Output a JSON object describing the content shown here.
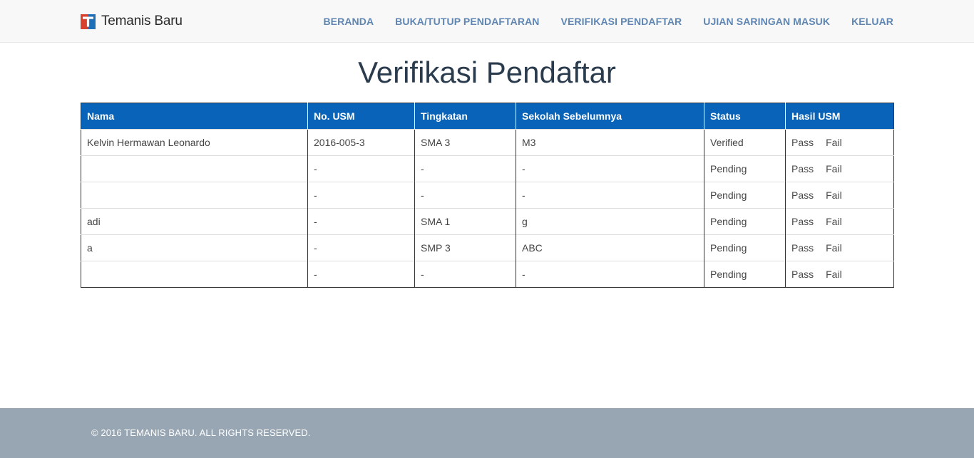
{
  "brand": {
    "name": "Temanis Baru",
    "logo_colors": {
      "left": "#d9412f",
      "right": "#1f6fb8"
    }
  },
  "nav": {
    "items": [
      {
        "label": "BERANDA"
      },
      {
        "label": "BUKA/TUTUP PENDAFTARAN"
      },
      {
        "label": "VERIFIKASI PENDAFTAR"
      },
      {
        "label": "UJIAN SARINGAN MASUK"
      },
      {
        "label": "KELUAR"
      }
    ]
  },
  "page": {
    "title": "Verifikasi Pendaftar"
  },
  "table": {
    "headers": [
      "Nama",
      "No. USM",
      "Tingkatan",
      "Sekolah Sebelumnya",
      "Status",
      "Hasil USM"
    ],
    "rows": [
      {
        "nama": "Kelvin Hermawan Leonardo",
        "usm": "2016-005-3",
        "tingkatan": "SMA 3",
        "sekolah": "M3",
        "status": "Verified",
        "pass": "Pass",
        "fail": "Fail"
      },
      {
        "nama": "",
        "usm": "-",
        "tingkatan": "-",
        "sekolah": "-",
        "status": "Pending",
        "pass": "Pass",
        "fail": "Fail"
      },
      {
        "nama": "",
        "usm": "-",
        "tingkatan": "-",
        "sekolah": "-",
        "status": "Pending",
        "pass": "Pass",
        "fail": "Fail"
      },
      {
        "nama": "adi",
        "usm": "-",
        "tingkatan": "SMA 1",
        "sekolah": "g",
        "status": "Pending",
        "pass": "Pass",
        "fail": "Fail"
      },
      {
        "nama": "a",
        "usm": "-",
        "tingkatan": "SMP 3",
        "sekolah": "ABC",
        "status": "Pending",
        "pass": "Pass",
        "fail": "Fail"
      },
      {
        "nama": "",
        "usm": "-",
        "tingkatan": "-",
        "sekolah": "-",
        "status": "Pending",
        "pass": "Pass",
        "fail": "Fail"
      }
    ]
  },
  "footer": {
    "text": "© 2016 TEMANIS BARU. ALL RIGHTS RESERVED."
  },
  "colors": {
    "accent": "#0963b8",
    "nav_link": "#5f86b2",
    "footer_bg": "#98a6b3"
  }
}
